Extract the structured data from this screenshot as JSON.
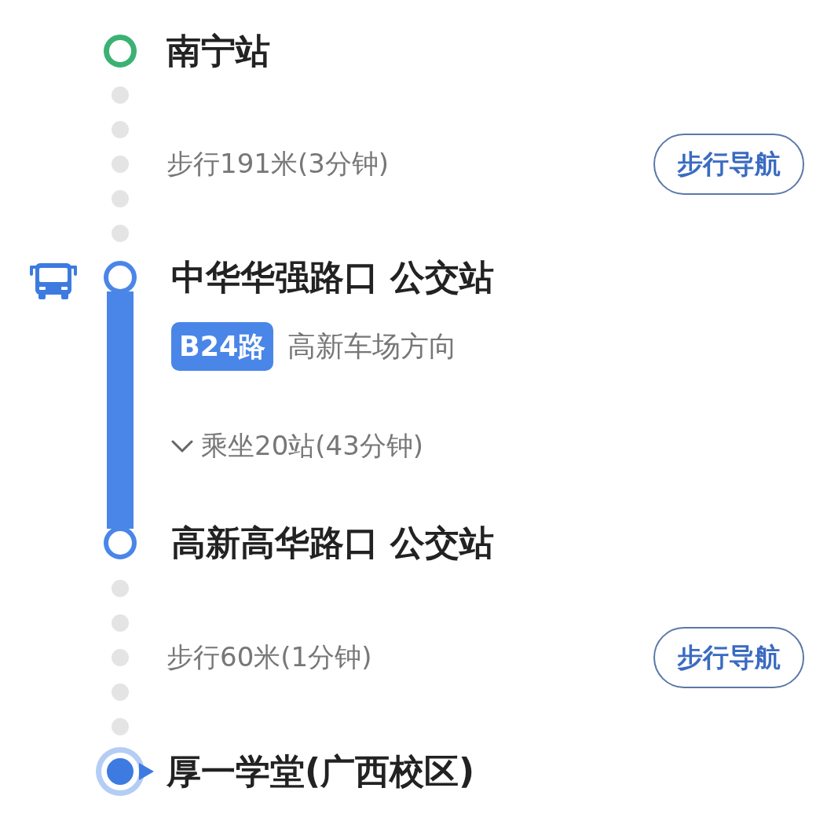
{
  "route": {
    "steps": [
      {
        "kind": "start",
        "name": "南宁站"
      },
      {
        "kind": "walk",
        "summary": "步行191米(3分钟)",
        "button": "步行导航"
      },
      {
        "kind": "bus",
        "board_stop": "中华华强路口 公交站",
        "line": "B24路",
        "direction": "高新车场方向",
        "ride": "乘坐20站(43分钟)",
        "expanded": false,
        "alight_stop": "高新高华路口 公交站"
      },
      {
        "kind": "walk",
        "summary": "步行60米(1分钟)",
        "button": "步行导航"
      },
      {
        "kind": "end",
        "name": "厚一学堂(广西校区)"
      }
    ]
  }
}
